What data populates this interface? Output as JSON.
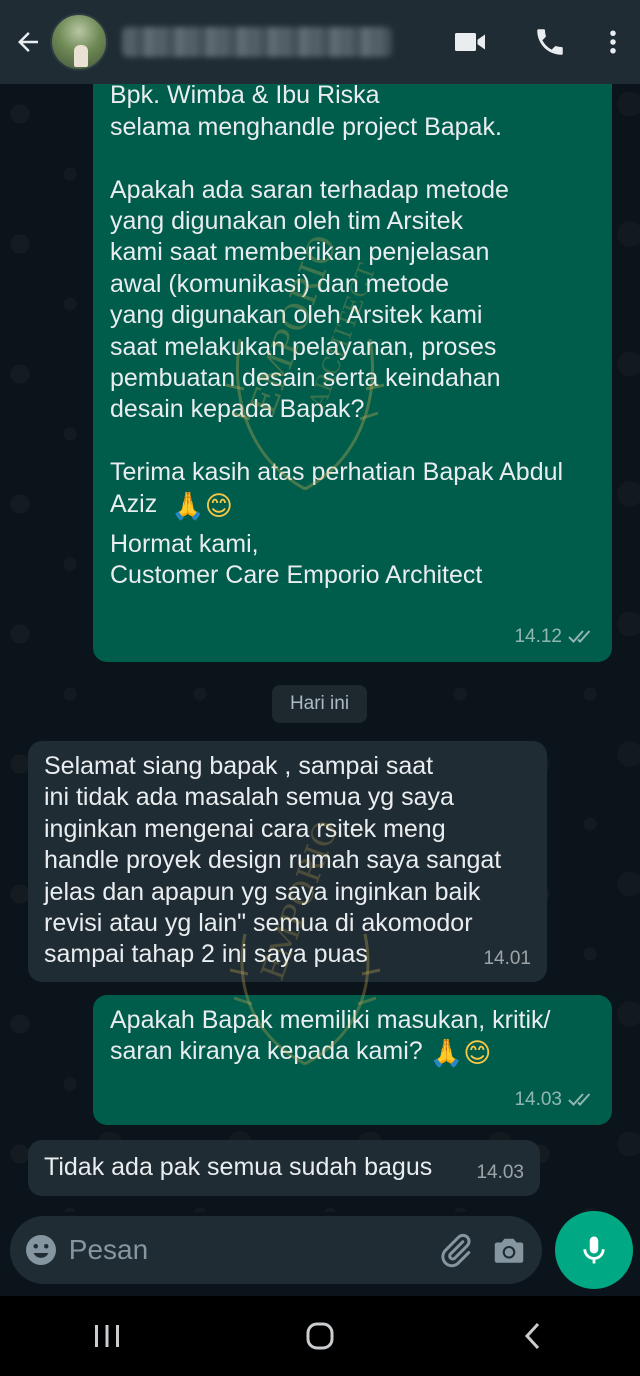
{
  "header": {
    "back_icon": "arrow-left-icon",
    "contact_name": "",
    "actions": [
      "video-call-icon",
      "voice-call-icon",
      "more-options-icon"
    ]
  },
  "messages": [
    {
      "id": "m1",
      "direction": "outgoing",
      "text": "Bpk. Wimba & Ibu Riska\nselama menghandle project Bapak.\n\nApakah ada saran terhadap metode\nyang digunakan oleh tim Arsitek\nkami saat memberikan penjelasan\nawal (komunikasi) dan metode\nyang digunakan oleh Arsitek kami\nsaat melakukan pelayanan, proses\npembuatan desain serta keindahan\ndesain kepada Bapak?\n\nTerima kasih atas perhatian Bapak Abdul\nAziz",
      "emoji": [
        "🙏",
        "😊"
      ],
      "closing": "Hormat kami,\nCustomer Care Emporio Architect",
      "time": "14.12",
      "status": "read"
    },
    {
      "id": "m2",
      "direction": "incoming",
      "text": "Selamat siang bapak , sampai saat\nini tidak ada masalah semua yg saya\ninginkan mengenai cara rsitek meng\nhandle proyek design rumah saya sangat\njelas dan apapun yg saya inginkan baik\nrevisi atau yg lain\" semua di akomodor\nsampai tahap 2 ini saya puas",
      "time": "14.01"
    },
    {
      "id": "m3",
      "direction": "outgoing",
      "text": "Apakah Bapak memiliki masukan, kritik/\nsaran kiranya kepada kami?",
      "emoji": [
        "🙏",
        "😊"
      ],
      "time": "14.03",
      "status": "read"
    },
    {
      "id": "m4",
      "direction": "incoming",
      "text": "Tidak ada pak semua sudah bagus",
      "time": "14.03"
    }
  ],
  "date_separator": "Hari ini",
  "watermark_text": "EMPORIO ARCHITECT",
  "composer": {
    "placeholder": "Pesan",
    "icons": [
      "emoji-icon",
      "attach-icon",
      "camera-icon",
      "mic-icon"
    ]
  },
  "colors": {
    "outgoing_bubble": "#005c4b",
    "incoming_bubble": "#202c33",
    "accent": "#00a884",
    "header": "#1f2c34",
    "background": "#0b141a"
  },
  "system_nav": [
    "recent-apps-icon",
    "home-icon",
    "back-icon"
  ]
}
